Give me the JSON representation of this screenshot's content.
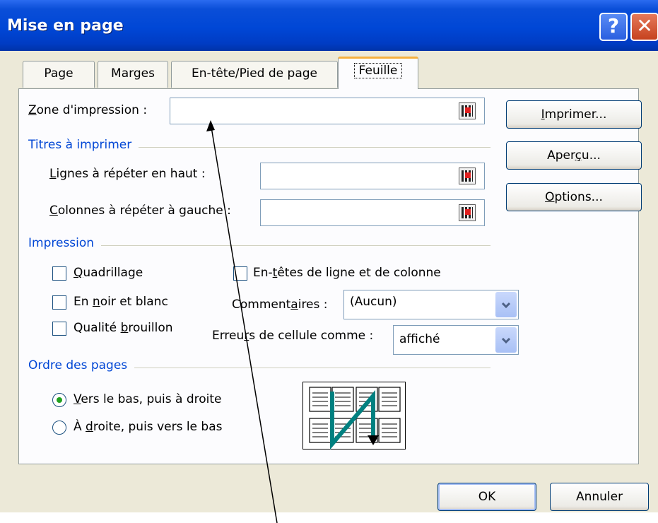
{
  "window": {
    "title": "Mise en page",
    "help": "?",
    "close": "✕"
  },
  "tabs": [
    {
      "label": "Page"
    },
    {
      "label": "Marges"
    },
    {
      "label": "En-tête/Pied de page"
    },
    {
      "label": "Feuille"
    }
  ],
  "print_area": {
    "label_u": "Z",
    "label_rest": "one d'impression :",
    "value": ""
  },
  "titles": {
    "group": "Titres à imprimer",
    "rows_u": "L",
    "rows_rest": "ignes à répéter en haut :",
    "rows_value": "",
    "cols_u": "C",
    "cols_rest": "olonnes à répéter à gauche :",
    "cols_value": ""
  },
  "print": {
    "group": "Impression",
    "gridlines_u": "Q",
    "gridlines_rest": "uadrillage",
    "bw_a": "En ",
    "bw_u": "n",
    "bw_b": "oir et blanc",
    "draft_a": "Qualité ",
    "draft_u": "b",
    "draft_b": "rouillon",
    "headings_a": "En-",
    "headings_u": "t",
    "headings_b": "êtes de ligne et de colonne",
    "comments_a": "Comment",
    "comments_u": "a",
    "comments_b": "ires :",
    "comments_value": "(Aucun)",
    "errors_a": "Erreu",
    "errors_u": "r",
    "errors_b": "s de cellule comme :",
    "errors_value": "affiché"
  },
  "page_order": {
    "group": "Ordre des pages",
    "down_u": "V",
    "down_rest": "ers le bas, puis à droite",
    "over_a": "À ",
    "over_u": "d",
    "over_b": "roite, puis vers le bas"
  },
  "side_buttons": {
    "print_u": "I",
    "print_rest": "mprimer...",
    "preview_a": "Aper",
    "preview_u": "ç",
    "preview_b": "u...",
    "options_u": "O",
    "options_rest": "ptions..."
  },
  "footer": {
    "ok": "OK",
    "cancel": "Annuler"
  },
  "colors": {
    "titlebar": "#0047d6",
    "group_text": "#0046d5",
    "active_tab_accent": "#f5b03d",
    "page_order_arrow": "#008080"
  }
}
